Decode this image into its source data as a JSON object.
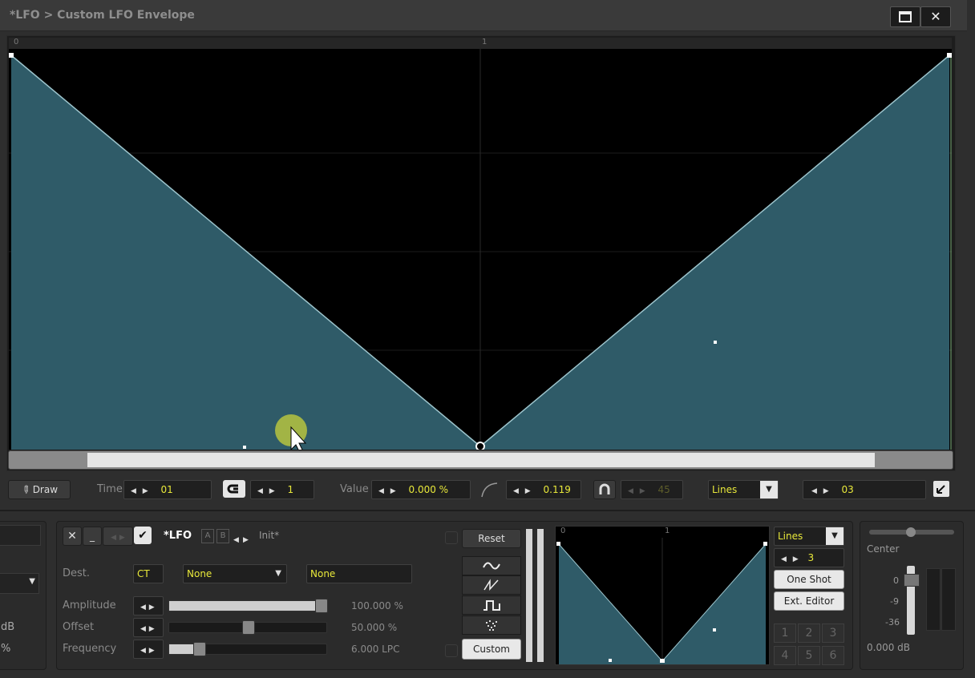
{
  "window": {
    "title": "*LFO > Custom LFO Envelope",
    "maximize_icon": "maximize-icon",
    "close_glyph": "✕"
  },
  "envelope": {
    "ruler_start": "0",
    "ruler_mid": "1",
    "fill_color": "#2f5b68",
    "line_color": "#9cc4cc"
  },
  "toolbar": {
    "draw_label": "Draw",
    "time_label": "Time",
    "time_value": "01",
    "snap_value": "1",
    "value_label": "Value",
    "value_value": "0.000 %",
    "curve_value": "0.119",
    "angle_value": "45",
    "mode_value": "Lines",
    "points_value": "03"
  },
  "lfo": {
    "name": "*LFO",
    "ab_a": "A",
    "ab_b": "B",
    "preset": "Init*",
    "dest_label": "Dest.",
    "dest_track": "CT",
    "dest_param1": "None",
    "dest_param2": "None",
    "amplitude_label": "Amplitude",
    "amplitude_value": "100.000 %",
    "amplitude_level": 1.0,
    "offset_label": "Offset",
    "offset_value": "50.000 %",
    "offset_level": 0.5,
    "frequency_label": "Frequency",
    "frequency_value": "6.000 LPC",
    "frequency_level": 0.2,
    "reset_label": "Reset",
    "custom_label": "Custom",
    "shape_icons": [
      "sine-icon",
      "saw-icon",
      "square-icon",
      "random-icon"
    ]
  },
  "mini": {
    "ruler_start": "0",
    "ruler_mid": "1",
    "mode_value": "Lines",
    "points_value": "3",
    "one_shot_label": "One Shot",
    "ext_editor_label": "Ext. Editor",
    "slots": [
      "1",
      "2",
      "3",
      "4",
      "5",
      "6"
    ]
  },
  "mixer": {
    "pan_label": "Center",
    "db_0": "0",
    "db_9": "-9",
    "db_36": "-36",
    "level_value": "0.000 dB"
  },
  "left_partial": {
    "db": "dB",
    "pct": "%"
  }
}
